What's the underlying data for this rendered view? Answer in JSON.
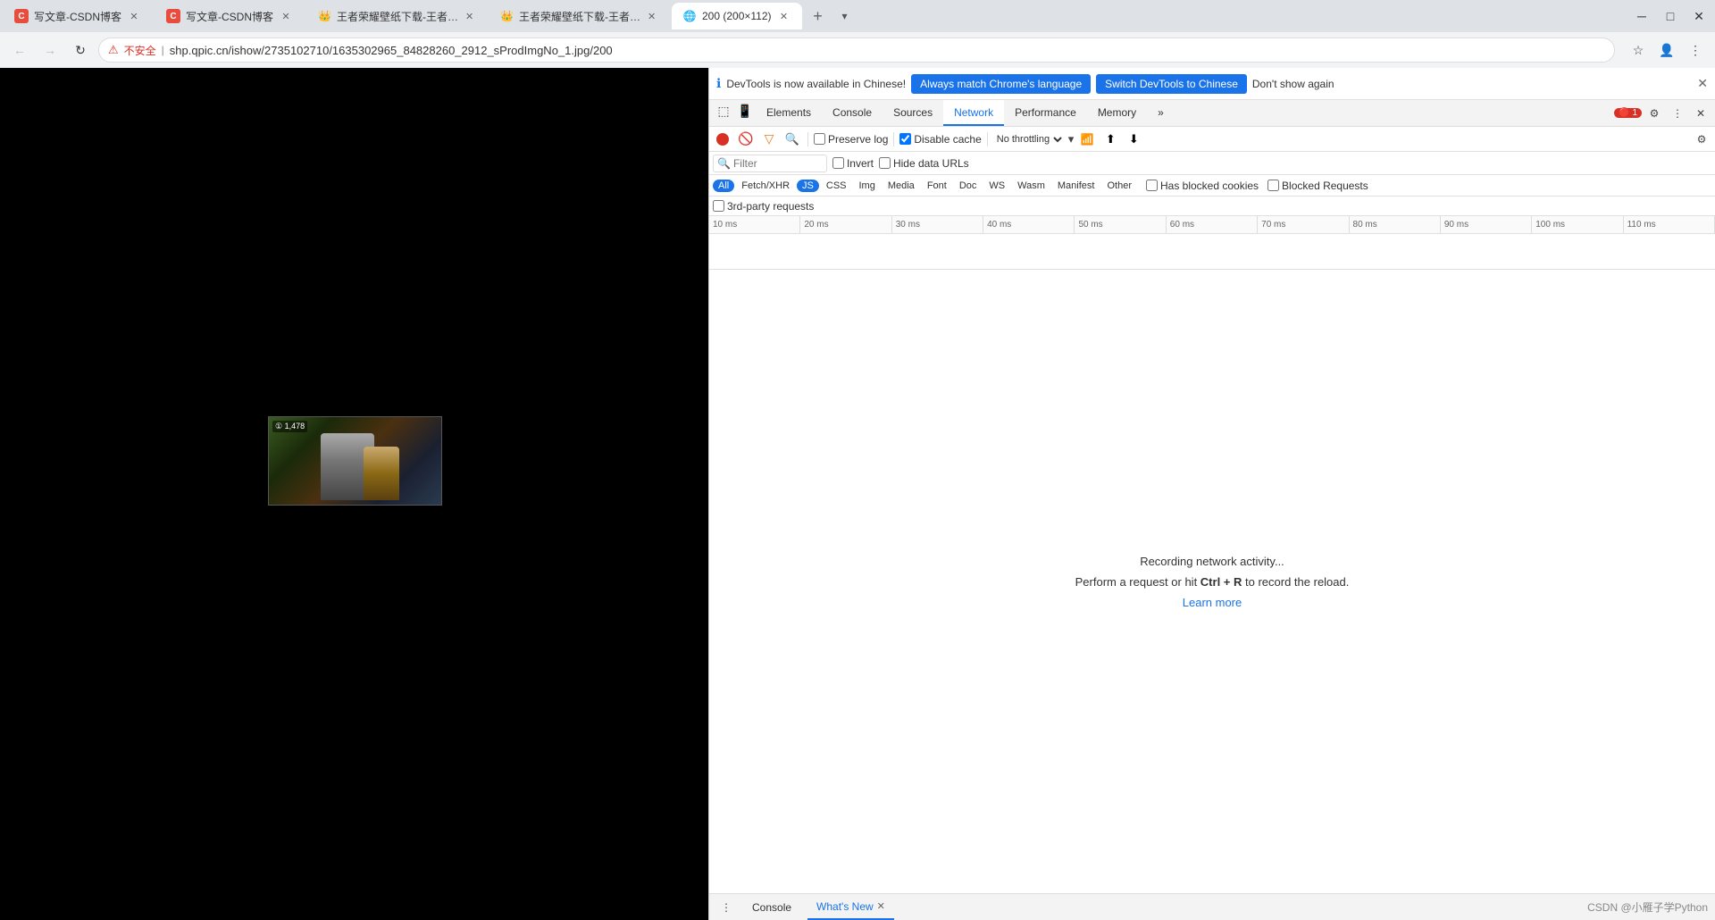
{
  "browser": {
    "tabs": [
      {
        "id": 1,
        "title": "写文章-CSDN博客",
        "icon": "C",
        "icon_color": "#e74c3c",
        "active": false
      },
      {
        "id": 2,
        "title": "写文章-CSDN博客",
        "icon": "C",
        "icon_color": "#e74c3c",
        "active": false
      },
      {
        "id": 3,
        "title": "王者荣耀壁纸下载-王者荣耀官方",
        "icon": "👑",
        "active": false
      },
      {
        "id": 4,
        "title": "王者荣耀壁纸下载-王者荣耀官方",
        "icon": "👑",
        "active": false
      },
      {
        "id": 5,
        "title": "200 (200×112)",
        "icon": "🌐",
        "active": true
      }
    ],
    "url": "shp.qpic.cn/ishow/2735102710/1635302965_84828260_2912_sProdImgNo_1.jpg/200",
    "security_label": "不安全"
  },
  "devtools": {
    "notification": {
      "info_text": "DevTools is now available in Chinese!",
      "btn1": "Always match Chrome's language",
      "btn2": "Switch DevTools to Chinese",
      "dismiss": "Don't show again"
    },
    "tabs": [
      "Elements",
      "Console",
      "Sources",
      "Network",
      "Performance",
      "Memory",
      "»"
    ],
    "active_tab": "Network",
    "error_count": "1",
    "network": {
      "preserve_log": "Preserve log",
      "disable_cache": "Disable cache",
      "throttle": "No throttling",
      "filter_placeholder": "Filter",
      "invert_label": "Invert",
      "hide_data_urls": "Hide data URLs",
      "type_filters": [
        "All",
        "Fetch/XHR",
        "JS",
        "CSS",
        "Img",
        "Media",
        "Font",
        "Doc",
        "WS",
        "Wasm",
        "Manifest",
        "Other"
      ],
      "has_blocked_cookies": "Has blocked cookies",
      "blocked_requests": "Blocked Requests",
      "third_party": "3rd-party requests",
      "timeline_marks": [
        "10 ms",
        "20 ms",
        "30 ms",
        "40 ms",
        "50 ms",
        "60 ms",
        "70 ms",
        "80 ms",
        "90 ms",
        "100 ms",
        "110 ms"
      ],
      "recording_text": "Recording network activity...",
      "recording_hint_pre": "Perform a request or hit ",
      "recording_hint_key": "Ctrl + R",
      "recording_hint_post": " to record the reload.",
      "learn_more": "Learn more"
    }
  },
  "bottom_bar": {
    "console_label": "Console",
    "whats_new_label": "What's New",
    "watermark": "CSDN @小雁子学Python"
  }
}
